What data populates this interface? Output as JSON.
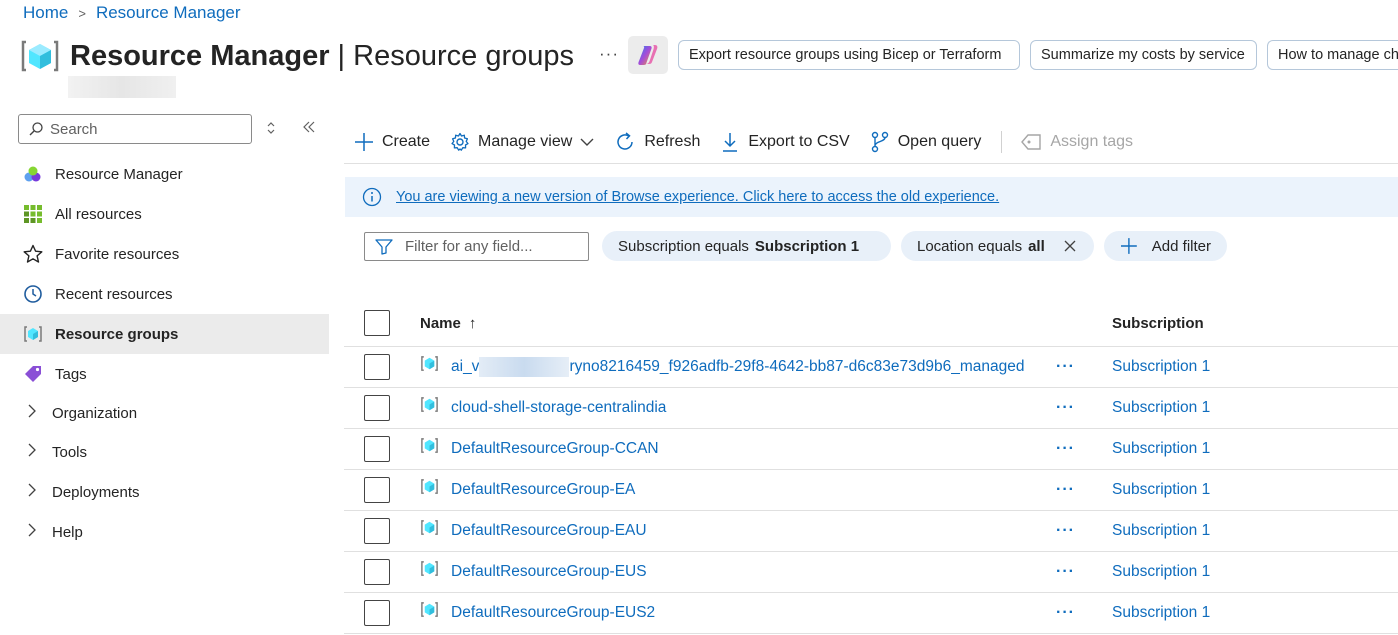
{
  "breadcrumb": {
    "home": "Home",
    "separator": ">",
    "current": "Resource Manager"
  },
  "header": {
    "title_bold": "Resource Manager",
    "title_sep": " | ",
    "title_rest": "Resource groups",
    "more": "···",
    "prompts": [
      "Export resource groups using Bicep or Terraform",
      "Summarize my costs by service",
      "How to manage ch"
    ]
  },
  "sidebar": {
    "search_placeholder": "Search",
    "items": [
      {
        "label": "Resource Manager",
        "icon": "resource-manager-icon"
      },
      {
        "label": "All resources",
        "icon": "grid-icon"
      },
      {
        "label": "Favorite resources",
        "icon": "star-icon"
      },
      {
        "label": "Recent resources",
        "icon": "clock-icon"
      },
      {
        "label": "Resource groups",
        "icon": "resource-group-icon",
        "active": true
      },
      {
        "label": "Tags",
        "icon": "tag-icon"
      }
    ],
    "groups": [
      {
        "label": "Organization"
      },
      {
        "label": "Tools"
      },
      {
        "label": "Deployments"
      },
      {
        "label": "Help"
      }
    ]
  },
  "toolbar": {
    "create": "Create",
    "manage_view": "Manage view",
    "refresh": "Refresh",
    "export_csv": "Export to CSV",
    "open_query": "Open query",
    "assign_tags": "Assign tags"
  },
  "banner": {
    "text": "You are viewing a new version of Browse experience. Click here to access the old experience."
  },
  "filters": {
    "placeholder": "Filter for any field...",
    "chip1_label": "Subscription equals ",
    "chip1_value": "Subscription 1",
    "chip2_label": "Location equals ",
    "chip2_value": "all",
    "add_filter": "Add filter"
  },
  "table": {
    "col_name": "Name",
    "sort_arrow": "↑",
    "col_subscription": "Subscription",
    "rows": [
      {
        "name_prefix": "ai_v",
        "name_suffix": "ryno8216459_f926adfb-29f8-4642-bb87-d6c83e73d9b6_managed",
        "subscription": "Subscription 1"
      },
      {
        "name": "cloud-shell-storage-centralindia",
        "subscription": "Subscription 1"
      },
      {
        "name": "DefaultResourceGroup-CCAN",
        "subscription": "Subscription 1"
      },
      {
        "name": "DefaultResourceGroup-EA",
        "subscription": "Subscription 1"
      },
      {
        "name": "DefaultResourceGroup-EAU",
        "subscription": "Subscription 1"
      },
      {
        "name": "DefaultResourceGroup-EUS",
        "subscription": "Subscription 1"
      },
      {
        "name": "DefaultResourceGroup-EUS2",
        "subscription": "Subscription 1"
      }
    ],
    "row_more": "···"
  },
  "colors": {
    "link": "#0f6cbd",
    "banner_bg": "#ebf3fc",
    "chip_bg": "#e8f0f9",
    "active_nav_bg": "#ebebeb"
  }
}
